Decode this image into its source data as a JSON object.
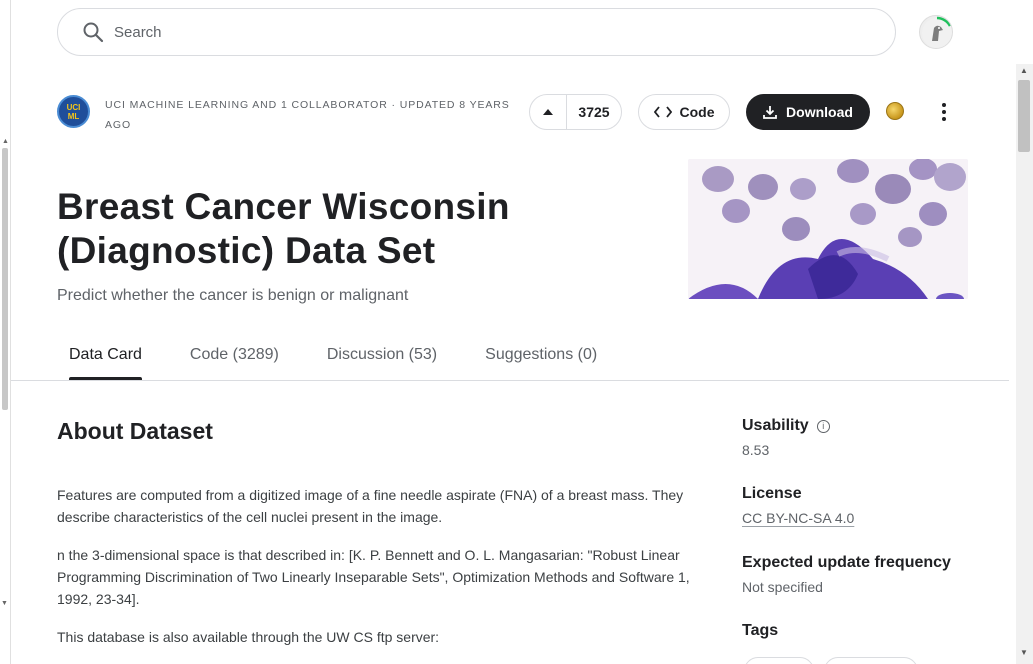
{
  "search": {
    "placeholder": "Search",
    "icon": "search-icon"
  },
  "header": {
    "owner_logo_line1": "UCI",
    "owner_logo_line2": "ML",
    "owner_line": "UCI Machine Learning and 1 collaborator · Updated 8 years ago",
    "vote_count": "3725",
    "code_label": "Code",
    "download_label": "Download"
  },
  "dataset": {
    "title": "Breast Cancer Wisconsin (Diagnostic) Data Set",
    "subtitle": "Predict whether the cancer is benign or malignant"
  },
  "tabs": [
    {
      "label": "Data Card",
      "active": true
    },
    {
      "label": "Code (3289)",
      "active": false
    },
    {
      "label": "Discussion (53)",
      "active": false
    },
    {
      "label": "Suggestions (0)",
      "active": false
    }
  ],
  "about": {
    "heading": "About Dataset",
    "paragraphs": [
      "Features are computed from a digitized image of a fine needle aspirate (FNA) of a breast mass. They describe characteristics of the cell nuclei present in the image.",
      "n the 3-dimensional space is that described in: [K. P. Bennett and O. L. Mangasarian: \"Robust Linear Programming Discrimination of Two Linearly Inseparable Sets\", Optimization Methods and Software 1, 1992, 23-34].",
      "This database is also available through the UW CS ftp server:"
    ]
  },
  "sidebar": {
    "usability_label": "Usability",
    "usability_value": "8.53",
    "license_label": "License",
    "license_value": "CC BY-NC-SA 4.0",
    "frequency_label": "Expected update frequency",
    "frequency_value": "Not specified",
    "tags_label": "Tags"
  },
  "colors": {
    "primary_text": "#202124",
    "secondary_text": "#5f6368",
    "border": "#dadce0",
    "download_bg": "#202124",
    "owner_logo_bg": "#1f4e9a"
  }
}
